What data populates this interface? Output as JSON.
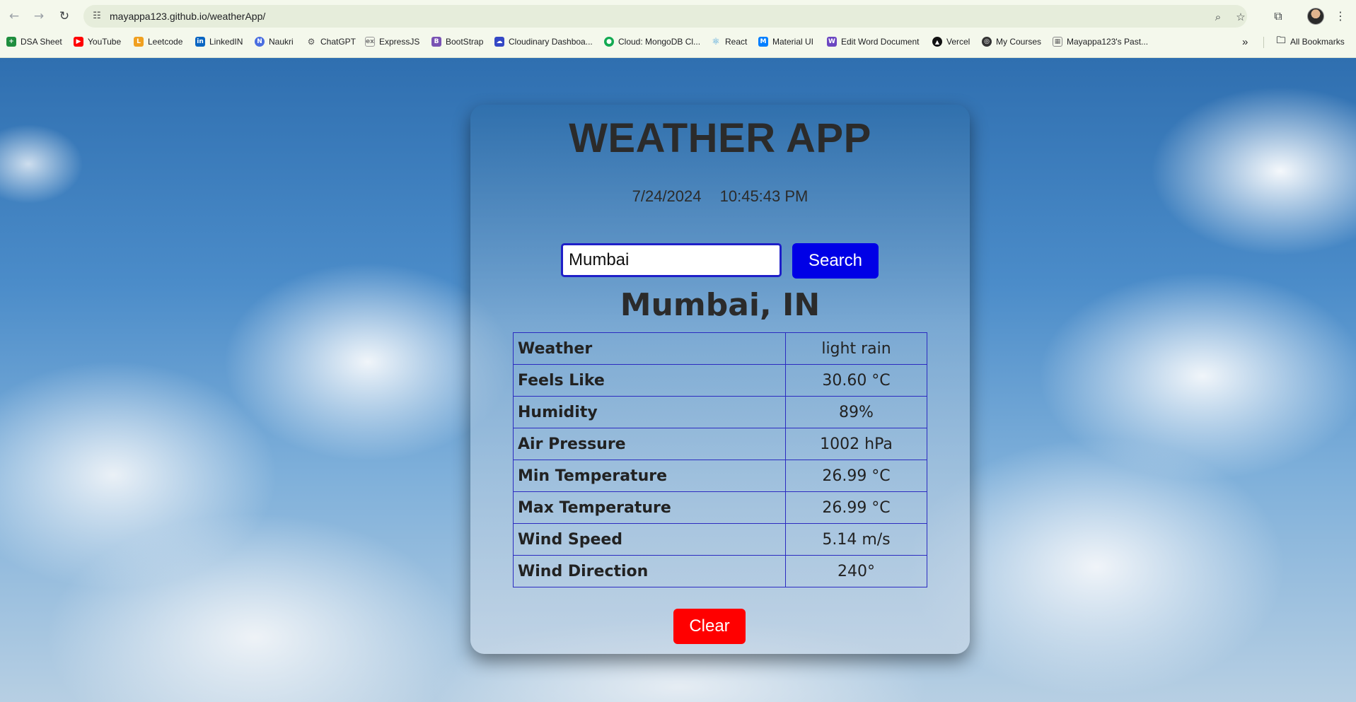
{
  "browser": {
    "url": "mayappa123.github.io/weatherApp/",
    "icons": {
      "back": "back-arrow-icon",
      "forward": "forward-arrow-icon",
      "reload": "reload-icon",
      "site_info": "tune-icon",
      "zoom": "zoom-icon",
      "bookmark": "star-icon",
      "extensions": "puzzle-icon",
      "menu": "kebab-menu-icon"
    },
    "bookmarks": [
      {
        "label": "DSA Sheet",
        "color": "#1e8e3e",
        "glyph": "+"
      },
      {
        "label": "YouTube",
        "color": "#ff0000",
        "glyph": "▶"
      },
      {
        "label": "Leetcode",
        "color": "#f0a020",
        "glyph": "L"
      },
      {
        "label": "LinkedIN",
        "color": "#0a66c2",
        "glyph": "in"
      },
      {
        "label": "Naukri",
        "color": "#4a6ee0",
        "glyph": "N"
      },
      {
        "label": "ChatGPT",
        "color": "#555555",
        "glyph": "⚙"
      },
      {
        "label": "ExpressJS",
        "color": "#777777",
        "glyph": "ex"
      },
      {
        "label": "BootStrap",
        "color": "#7952b3",
        "glyph": "B"
      },
      {
        "label": "Cloudinary Dashboa...",
        "color": "#3448c5",
        "glyph": "☁"
      },
      {
        "label": "Cloud: MongoDB Cl...",
        "color": "#13aa52",
        "glyph": "●"
      },
      {
        "label": "React",
        "color": "#3a9ad9",
        "glyph": "⚛"
      },
      {
        "label": "Material UI",
        "color": "#007fff",
        "glyph": "M"
      },
      {
        "label": "Edit Word Document",
        "color": "#6b46c1",
        "glyph": "W"
      },
      {
        "label": "Vercel",
        "color": "#111111",
        "glyph": "▲"
      },
      {
        "label": "My Courses",
        "color": "#333333",
        "glyph": "◎"
      },
      {
        "label": "Mayappa123's Past...",
        "color": "#666666",
        "glyph": "▦"
      }
    ],
    "more_bookmarks": "»",
    "all_bookmarks": "All Bookmarks"
  },
  "app": {
    "title": "WEATHER APP",
    "date": "7/24/2024",
    "time": "10:45:43 PM",
    "search": {
      "value": "Mumbai",
      "button": "Search"
    },
    "location": "Mumbai, IN",
    "rows": [
      {
        "label": "Weather",
        "value": "light rain"
      },
      {
        "label": "Feels Like",
        "value": "30.60 °C"
      },
      {
        "label": "Humidity",
        "value": "89%"
      },
      {
        "label": "Air Pressure",
        "value": "1002 hPa"
      },
      {
        "label": "Min Temperature",
        "value": "26.99 °C"
      },
      {
        "label": "Max Temperature",
        "value": "26.99 °C"
      },
      {
        "label": "Wind Speed",
        "value": "5.14 m/s"
      },
      {
        "label": "Wind Direction",
        "value": "240°"
      }
    ],
    "clear_button": "Clear"
  }
}
